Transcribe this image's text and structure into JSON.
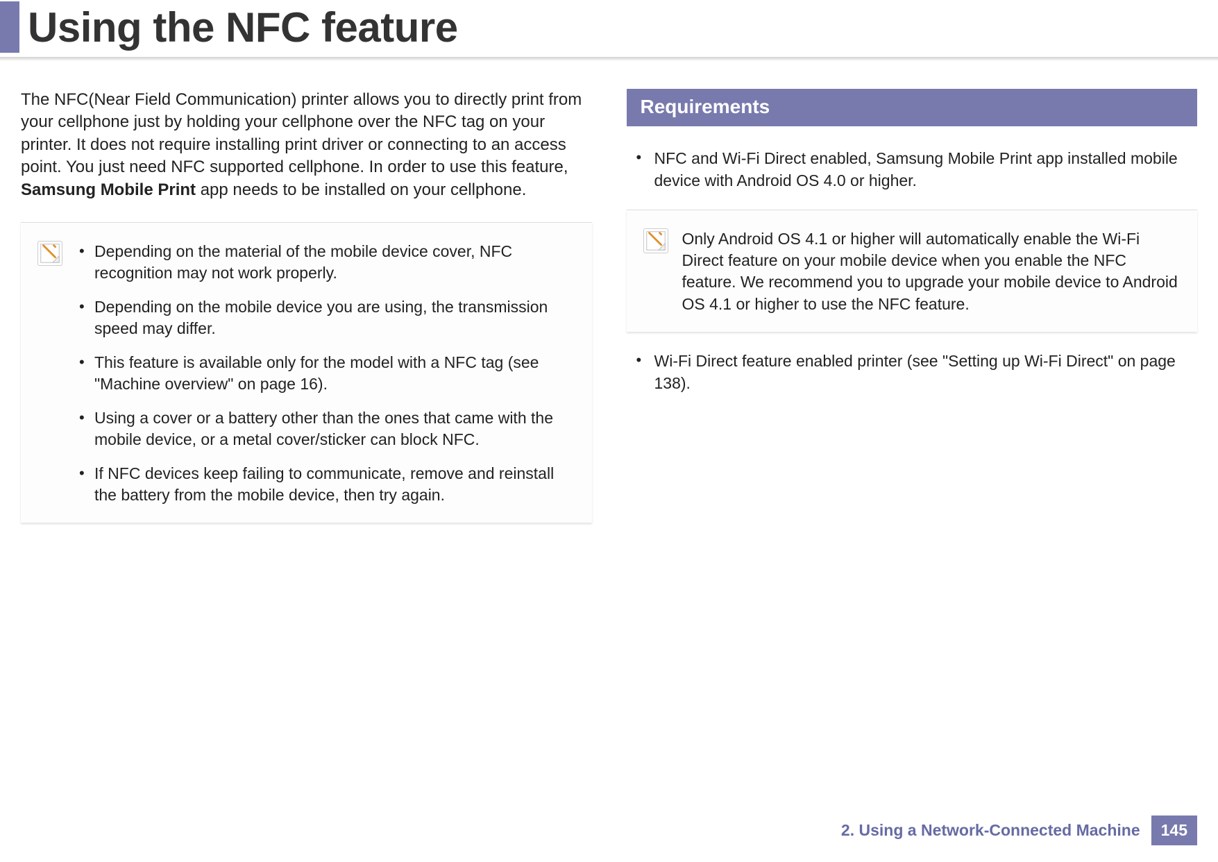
{
  "header": {
    "title": "Using the NFC feature"
  },
  "intro": {
    "pre": "The NFC(Near Field Communication) printer allows you to directly print from your cellphone just by holding your cellphone over the NFC tag on your printer. It does not require installing print driver or connecting to an access point. You just need NFC supported cellphone. In order to use this feature, ",
    "bold": "Samsung Mobile Print",
    "post": " app needs to be installed on your cellphone."
  },
  "left_note": {
    "items": [
      "Depending on the material of the mobile device cover, NFC recognition may not work properly.",
      "Depending on the mobile device you are using, the transmission speed may differ.",
      "This feature is available only for the model with a NFC tag (see \"Machine overview\" on page 16).",
      "Using a cover or a battery other than the ones that came with the mobile device, or a metal cover/sticker can block NFC.",
      "If NFC devices keep failing to communicate, remove and reinstall the battery from the mobile device, then try again."
    ]
  },
  "right": {
    "section_title": "Requirements",
    "req1": "NFC and Wi-Fi Direct enabled, Samsung Mobile Print app installed mobile device with Android OS 4.0 or higher.",
    "note": "Only Android OS 4.1 or higher will automatically enable the Wi-Fi Direct feature on your mobile device when you enable the NFC feature. We recommend you to upgrade your mobile device to Android OS 4.1 or higher to use the NFC feature.",
    "req2": "Wi-Fi Direct feature enabled printer (see \"Setting up Wi-Fi Direct\" on page 138)."
  },
  "footer": {
    "chapter": "2.  Using a Network-Connected Machine",
    "page": "145"
  }
}
